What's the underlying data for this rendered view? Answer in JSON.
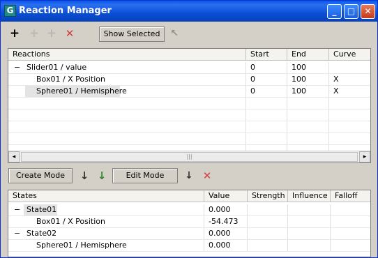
{
  "window": {
    "title": "Reaction Manager",
    "app_icon": "G",
    "controls": {
      "minimize": "_",
      "maximize": "□",
      "close": "✕"
    }
  },
  "toolbar": {
    "add_icon": "+",
    "add_disabled_icon": "+",
    "add_disabled2_icon": "+",
    "delete_icon": "✕",
    "show_selected_label": "Show Selected",
    "pick_icon": "↖"
  },
  "reactions": {
    "headers": {
      "name": "Reactions",
      "start": "Start",
      "end": "End",
      "curve": "Curve"
    },
    "rows": [
      {
        "expander": "−",
        "name": "Slider01 / value",
        "start": "0",
        "end": "100",
        "curve": ""
      },
      {
        "expander": "",
        "name": "Box01 / X Position",
        "start": "0",
        "end": "100",
        "curve": "X"
      },
      {
        "expander": "",
        "name": "Sphere01 / Hemisphere",
        "start": "0",
        "end": "100",
        "curve": "X"
      }
    ],
    "scroll": {
      "left": "◂",
      "right": "▸",
      "grip": "|||"
    }
  },
  "states_toolbar": {
    "create_mode_label": "Create Mode",
    "edit_mode_label": "Edit Mode",
    "add_state_icon": "↓",
    "append_state_icon": "↓",
    "down_icon": "↓",
    "delete_icon": "✕"
  },
  "states": {
    "headers": {
      "name": "States",
      "value": "Value",
      "strength": "Strength",
      "influence": "Influence",
      "falloff": "Falloff"
    },
    "rows": [
      {
        "expander": "−",
        "name": "State01",
        "value": "0.000"
      },
      {
        "expander": "",
        "name": "Box01 / X Position",
        "value": "-54.473"
      },
      {
        "expander": "−",
        "name": "State02",
        "value": "0.000"
      },
      {
        "expander": "",
        "name": "Sphere01 / Hemisphere",
        "value": "0.000"
      }
    ]
  },
  "colors": {
    "titlebar": "#0a58e8",
    "delete": "#d04040",
    "add": "#2a8a2a"
  }
}
